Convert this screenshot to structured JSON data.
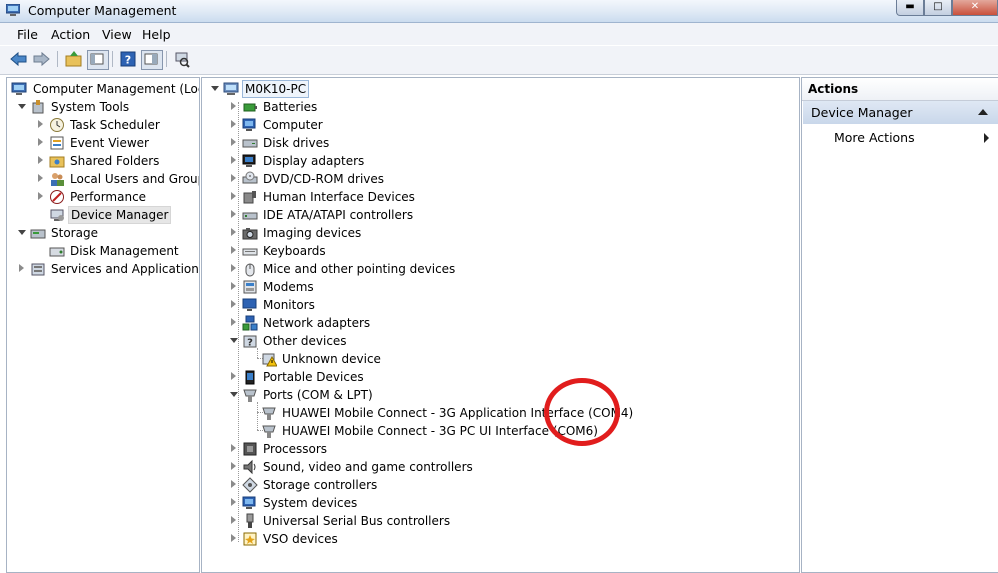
{
  "window": {
    "title": "Computer Management"
  },
  "menu": {
    "file": "File",
    "action": "Action",
    "view": "View",
    "help": "Help"
  },
  "tree": {
    "root": "Computer Management (Local",
    "system_tools": "System Tools",
    "task_scheduler": "Task Scheduler",
    "event_viewer": "Event Viewer",
    "shared_folders": "Shared Folders",
    "local_users": "Local Users and Groups",
    "performance": "Performance",
    "device_manager": "Device Manager",
    "storage": "Storage",
    "disk_management": "Disk Management",
    "services": "Services and Applications"
  },
  "devices": {
    "computer_name": "M0K10-PC",
    "batteries": "Batteries",
    "computer": "Computer",
    "disk_drives": "Disk drives",
    "display_adapters": "Display adapters",
    "dvd": "DVD/CD-ROM drives",
    "hid": "Human Interface Devices",
    "ide": "IDE ATA/ATAPI controllers",
    "imaging": "Imaging devices",
    "keyboards": "Keyboards",
    "mice": "Mice and other pointing devices",
    "modems": "Modems",
    "monitors": "Monitors",
    "network": "Network adapters",
    "other": "Other devices",
    "unknown": "Unknown device",
    "portable": "Portable Devices",
    "ports": "Ports (COM & LPT)",
    "port1": "HUAWEI Mobile Connect - 3G Application Interface (COM4)",
    "port2": "HUAWEI Mobile Connect - 3G PC UI Interface (COM6)",
    "processors": "Processors",
    "sound": "Sound, video and game controllers",
    "storage_ctrl": "Storage controllers",
    "system_devices": "System devices",
    "usb": "Universal Serial Bus controllers",
    "vso": "VSO devices"
  },
  "actions": {
    "header": "Actions",
    "device_manager": "Device Manager",
    "more": "More Actions"
  },
  "colors": {
    "highlight_circle": "#e11d1d",
    "selected_header": "#c9d7ea"
  }
}
